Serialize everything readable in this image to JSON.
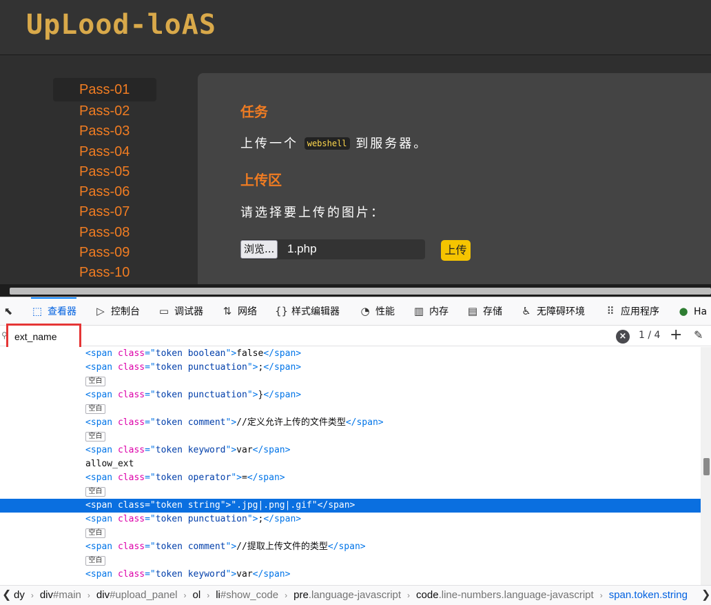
{
  "site": {
    "logo": "UpLood-loAS",
    "menu": [
      "Pass-01",
      "Pass-02",
      "Pass-03",
      "Pass-04",
      "Pass-05",
      "Pass-06",
      "Pass-07",
      "Pass-08",
      "Pass-09",
      "Pass-10"
    ],
    "active_menu": "Pass-01",
    "panel": {
      "task_heading": "任务",
      "task_before": "上传一个",
      "task_code": "webshell",
      "task_after": "到服务器。",
      "upload_heading": "上传区",
      "choose_label": "请选择要上传的图片：",
      "browse_label": "浏览...",
      "file_name": "1.php",
      "upload_button": "上传"
    }
  },
  "devtools": {
    "tabs": [
      {
        "icon": "⬚",
        "label": "查看器",
        "selected": true
      },
      {
        "icon": "▷",
        "label": "控制台"
      },
      {
        "icon": "▭",
        "label": "调试器"
      },
      {
        "icon": "⇅",
        "label": "网络"
      },
      {
        "icon": "{}",
        "label": "样式编辑器"
      },
      {
        "icon": "◔",
        "label": "性能"
      },
      {
        "icon": "▥",
        "label": "内存"
      },
      {
        "icon": "▤",
        "label": "存储"
      },
      {
        "icon": "♿",
        "label": "无障碍环境"
      },
      {
        "icon": "⠿",
        "label": "应用程序"
      },
      {
        "icon": "●",
        "label": "Ha"
      }
    ],
    "search": {
      "value": "ext_name",
      "count": "1 / 4"
    },
    "whitespace_badge": "空白",
    "lines": [
      {
        "kind": "span",
        "cls": "token boolean",
        "text": "false"
      },
      {
        "kind": "span",
        "cls": "token punctuation",
        "text": ";"
      },
      {
        "kind": "ws"
      },
      {
        "kind": "span",
        "cls": "token punctuation",
        "text": "}"
      },
      {
        "kind": "ws"
      },
      {
        "kind": "span",
        "cls": "token comment",
        "text": "//定义允许上传的文件类型"
      },
      {
        "kind": "ws"
      },
      {
        "kind": "span",
        "cls": "token keyword",
        "text": "var"
      },
      {
        "kind": "text",
        "text": "allow_ext"
      },
      {
        "kind": "span",
        "cls": "token operator",
        "text": "="
      },
      {
        "kind": "ws"
      },
      {
        "kind": "span",
        "cls": "token string",
        "text": "\".jpg|.png|.gif\"",
        "selected": true
      },
      {
        "kind": "span",
        "cls": "token punctuation",
        "text": ";"
      },
      {
        "kind": "ws"
      },
      {
        "kind": "span",
        "cls": "token comment",
        "text": "//提取上传文件的类型"
      },
      {
        "kind": "ws"
      },
      {
        "kind": "span",
        "cls": "token keyword",
        "text": "var"
      }
    ],
    "breadcrumb": [
      {
        "tag": "dy",
        "rest": ""
      },
      {
        "tag": "div",
        "rest": "#main"
      },
      {
        "tag": "div",
        "rest": "#upload_panel"
      },
      {
        "tag": "ol",
        "rest": ""
      },
      {
        "tag": "li",
        "rest": "#show_code"
      },
      {
        "tag": "pre",
        "rest": ".language-javascript"
      },
      {
        "tag": "code",
        "rest": ".line-numbers.language-javascript"
      },
      {
        "tag": "span",
        "rest": ".token.string",
        "current": true
      }
    ]
  },
  "colors": {
    "accent_orange": "#f07c22",
    "logo_gold": "#d9a94a",
    "upload_yellow": "#f5c400",
    "selection_blue": "#0a6fe0",
    "search_highlight_red": "#e53535"
  }
}
